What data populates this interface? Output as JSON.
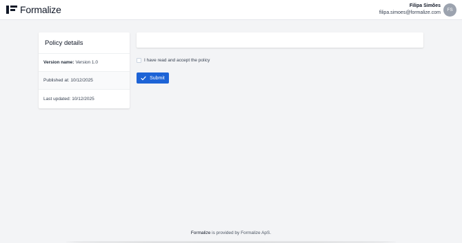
{
  "brand": {
    "name": "Formalize"
  },
  "user": {
    "name": "Filipa Simões",
    "email": "filipa.simoes@formalize.com",
    "initials": "FS"
  },
  "policy_details": {
    "title": "Policy details",
    "version_key": "Version name:",
    "version_value": "Version 1.0",
    "published": "Published at: 10/12/2025",
    "updated": "Last updated: 10/12/2025"
  },
  "form": {
    "accept_label": "I have read and accept the policy",
    "accept_checked": false,
    "submit_label": "Submit"
  },
  "footer": {
    "brand": "Formalize",
    "text": " is provided by Formalize ApS."
  },
  "colors": {
    "primary": "#1d63d6",
    "avatar": "#9ca3af",
    "background": "#f3f4f6"
  },
  "icons": [
    "formalize-logo-icon",
    "check-icon"
  ]
}
